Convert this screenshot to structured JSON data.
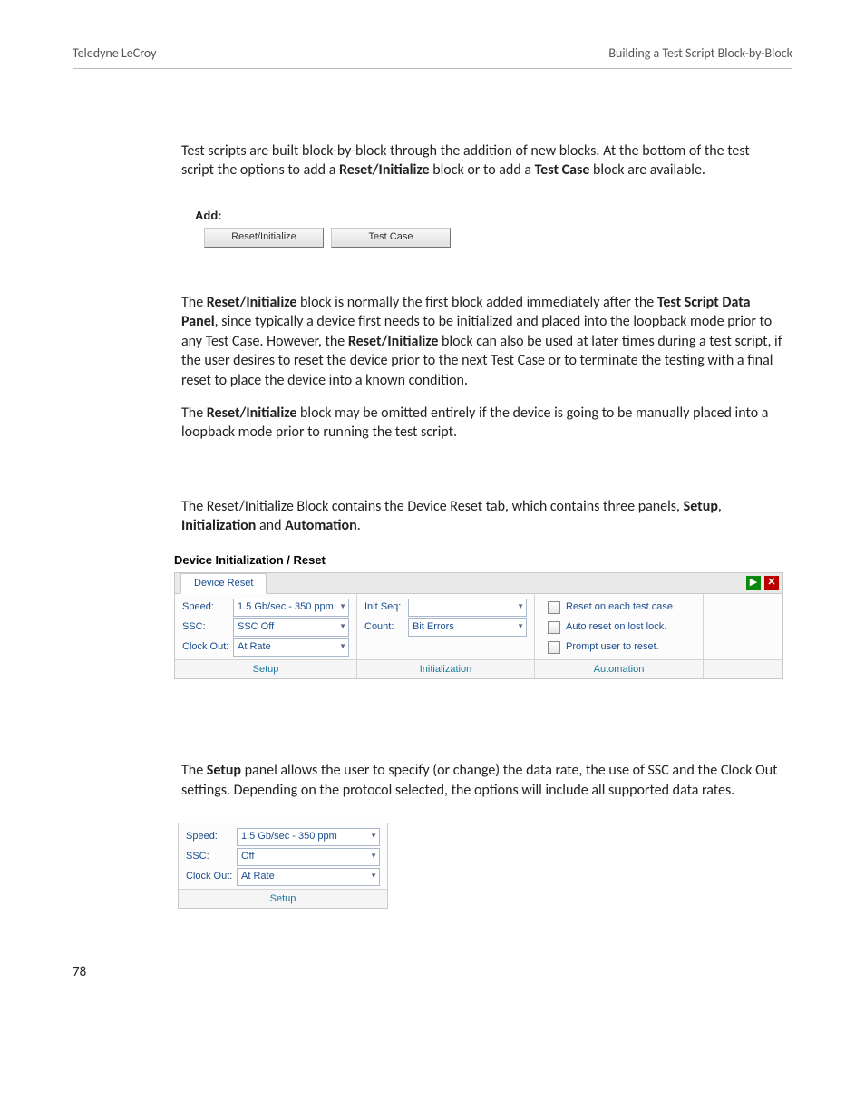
{
  "header": {
    "left": "Teledyne LeCroy",
    "right": "Building a Test Script Block-by-Block"
  },
  "para1": {
    "t1": "Test scripts are built block-by-block through the addition of new blocks. At the bottom of the test script the options to add a ",
    "b1": "Reset/Initialize",
    "t2": " block or to add a ",
    "b2": "Test Case",
    "t3": " block are available."
  },
  "add": {
    "label": "Add:",
    "btn1": "Reset/Initialize",
    "btn2": "Test Case"
  },
  "para2": {
    "t1": "The ",
    "b1": "Reset/Initialize",
    "t2": " block is normally the first block added immediately after the ",
    "b2": "Test Script Data Panel",
    "t3": ", since typically a device first needs to be initialized and placed into the loopback mode prior to any Test Case. However, the ",
    "b3": "Reset/Initialize",
    "t4": " block can also be used at later times during a test script, if the user desires to reset the device prior to the next Test Case or to terminate the testing with a final reset to place the device into a known condition."
  },
  "para3": {
    "t1": "The ",
    "b1": "Reset/Initialize",
    "t2": " block may be omitted entirely if the device is going to be manually placed into a loopback mode prior to running the test script."
  },
  "para4": {
    "t1": "The Reset/Initialize Block contains the Device Reset tab, which contains three panels, ",
    "b1": "Setup",
    "t2": ", ",
    "b2": "Initialization",
    "t3": " and ",
    "b3": "Automation",
    "t4": "."
  },
  "dev": {
    "title": "Device Initialization / Reset",
    "tab": "Device Reset",
    "setup": {
      "speed_l": "Speed:",
      "speed_v": "1.5 Gb/sec - 350 ppm",
      "ssc_l": "SSC:",
      "ssc_v": "SSC Off",
      "clk_l": "Clock Out:",
      "clk_v": "At Rate",
      "foot": "Setup"
    },
    "init": {
      "seq_l": "Init Seq:",
      "seq_v": "",
      "cnt_l": "Count:",
      "cnt_v": "Bit Errors",
      "foot": "Initialization"
    },
    "auto": {
      "c1": "Reset on each test case",
      "c2": "Auto reset on lost lock.",
      "c3": "Prompt user to reset.",
      "foot": "Automation"
    }
  },
  "para5": {
    "t1": "The ",
    "b1": "Setup",
    "t2": " panel allows the user to specify (or change) the data rate, the use of SSC and the Clock Out settings. Depending on the protocol selected, the options will include all supported data rates."
  },
  "setupfig": {
    "speed_l": "Speed:",
    "speed_v": "1.5 Gb/sec - 350 ppm",
    "ssc_l": "SSC:",
    "ssc_v": "Off",
    "clk_l": "Clock Out:",
    "clk_v": "At Rate",
    "foot": "Setup"
  },
  "page": "78"
}
